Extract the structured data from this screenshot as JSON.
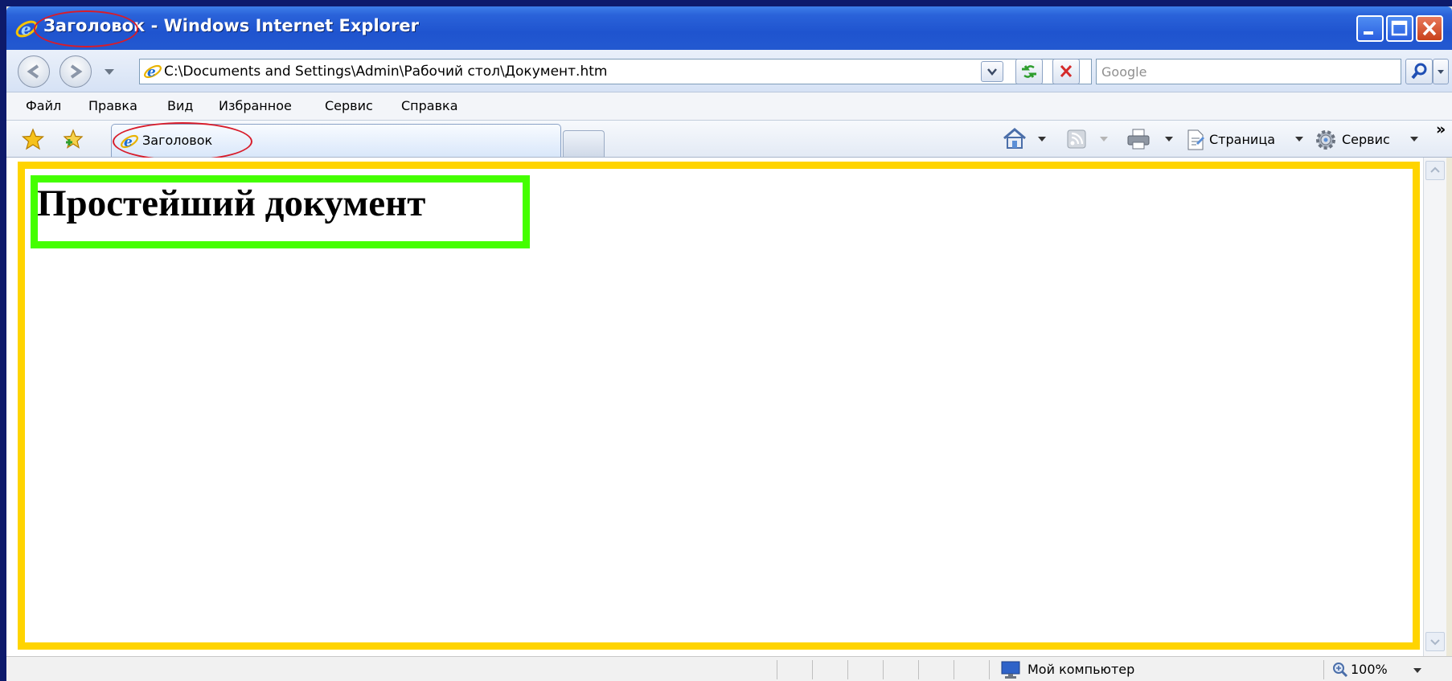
{
  "window": {
    "title": "Заголовок - Windows Internet Explorer"
  },
  "address_bar": {
    "url": "C:\\Documents and Settings\\Admin\\Рабочий стол\\Документ.htm",
    "search_placeholder": "Google"
  },
  "menu": {
    "items": [
      "Файл",
      "Правка",
      "Вид",
      "Избранное",
      "Сервис",
      "Справка"
    ]
  },
  "tabs": [
    {
      "label": "Заголовок",
      "active": true
    }
  ],
  "command_bar": {
    "page_label": "Страница",
    "tools_label": "Сервис",
    "overflow": "»"
  },
  "document": {
    "heading": "Простейший документ"
  },
  "status_bar": {
    "zone": "Мой компьютер",
    "zoom": "100%"
  },
  "colors": {
    "annotation_ellipse": "#d81c2a",
    "content_frame": "#ffd400",
    "heading_frame": "#44ff00"
  }
}
